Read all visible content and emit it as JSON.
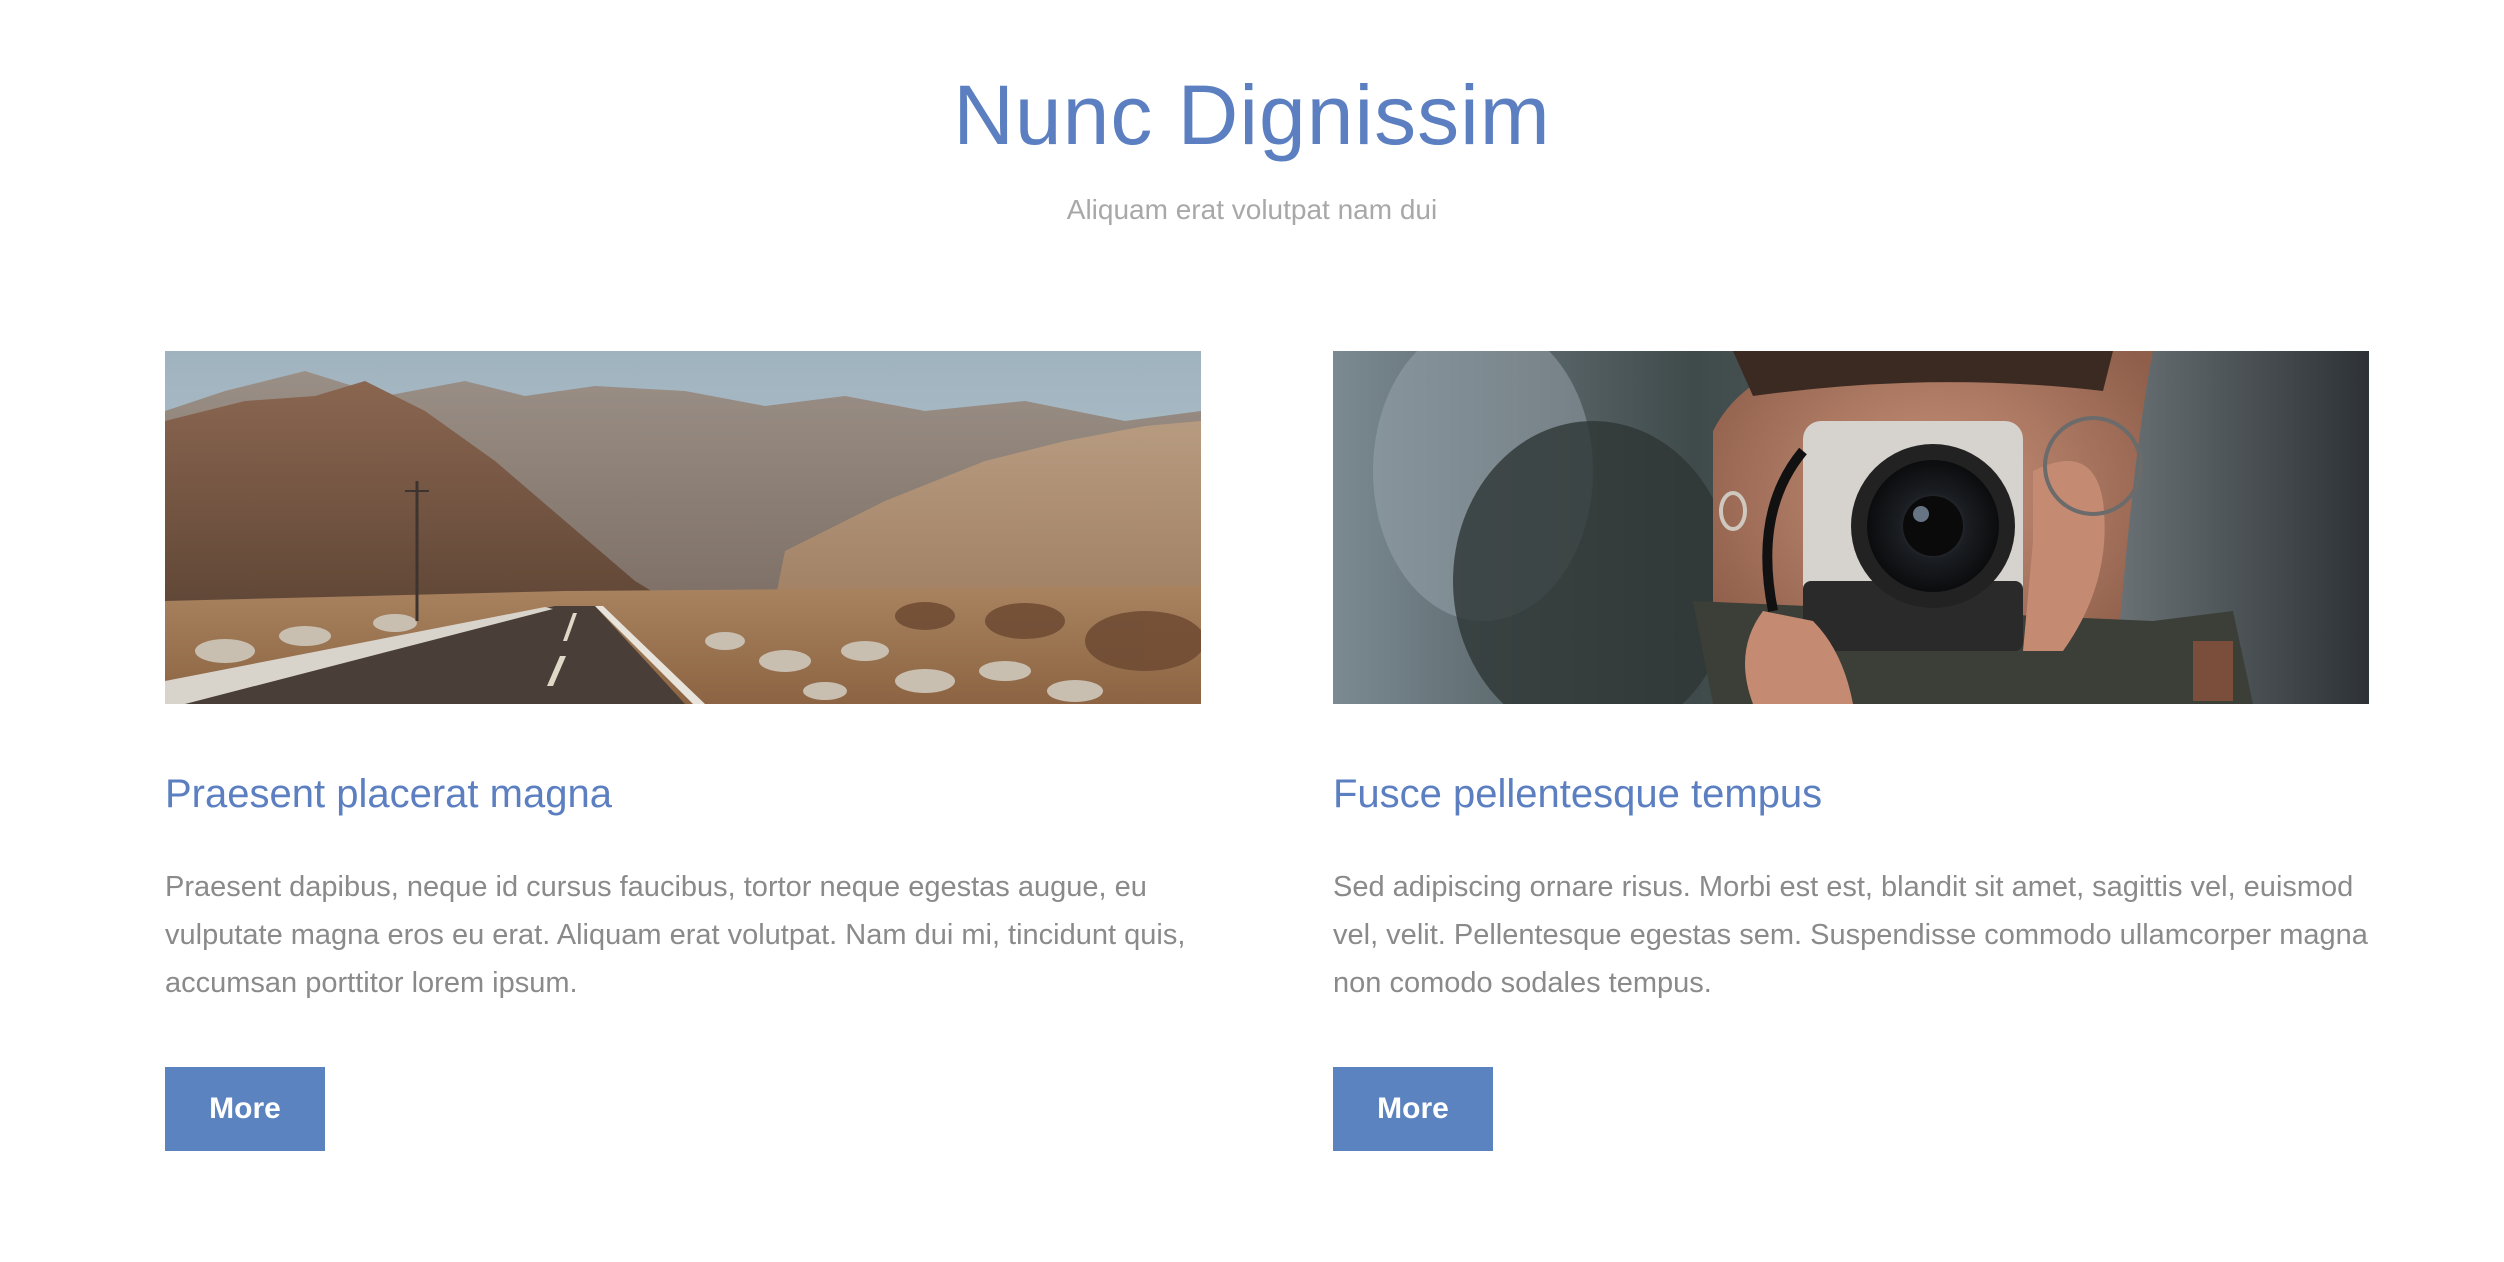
{
  "header": {
    "title": "Nunc Dignissim",
    "subtitle": "Aliquam erat volutpat nam dui"
  },
  "cards": [
    {
      "image": "desert-mountain-road-photo",
      "title": "Praesent placerat magna",
      "text": "Praesent dapibus, neque id cursus faucibus, tortor neque egestas augue, eu vulputate magna eros eu erat. Aliquam erat volutpat. Nam dui mi, tincidunt quis, accumsan porttitor lorem ipsum.",
      "button_label": "More"
    },
    {
      "image": "person-with-camera-photo",
      "title": "Fusce pellentesque tempus",
      "text": "Sed adipiscing ornare risus. Morbi est est, blandit sit amet, sagittis vel, euismod vel, velit. Pellentesque egestas sem. Suspendisse commodo ullamcorper magna non comodo sodales tempus.",
      "button_label": "More"
    }
  ],
  "colors": {
    "accent": "#5b7fc0",
    "button": "#5b83bf",
    "subtitle": "#a8a8a8",
    "body_text": "#8a8a8a"
  }
}
